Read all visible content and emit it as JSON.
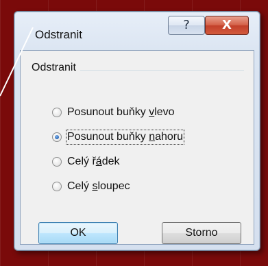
{
  "dialog": {
    "title": "Odstranit",
    "help_glyph": "?",
    "close_glyph": "X"
  },
  "group": {
    "label": "Odstranit"
  },
  "options": [
    {
      "pre": "Posunout buňky ",
      "key": "v",
      "post": "levo",
      "checked": false
    },
    {
      "pre": "Posunout buňky ",
      "key": "n",
      "post": "ahoru",
      "checked": true
    },
    {
      "pre": "Celý ř",
      "key": "á",
      "post": "dek",
      "checked": false
    },
    {
      "pre": "Celý ",
      "key": "s",
      "post": "loupec",
      "checked": false
    }
  ],
  "buttons": {
    "ok": "OK",
    "cancel": "Storno"
  },
  "colors": {
    "background": "#7a0a0a",
    "pointer_line": "#ffffff"
  }
}
